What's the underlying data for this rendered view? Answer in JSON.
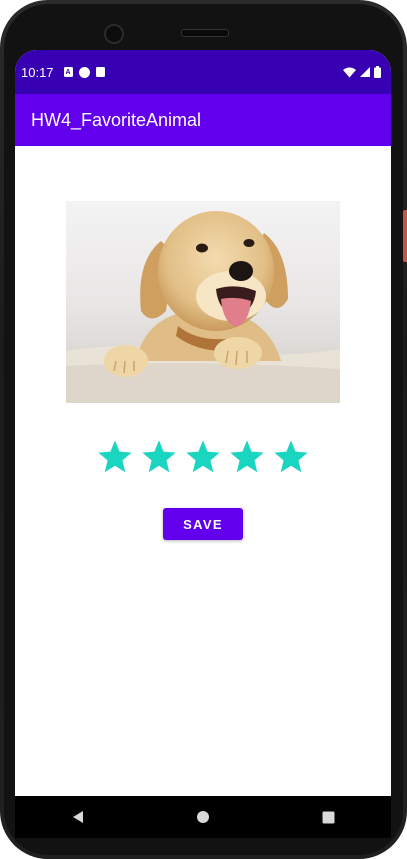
{
  "status_bar": {
    "time": "10:17",
    "left_icons": [
      "a-notification-icon",
      "circle-p-icon",
      "sd-card-icon"
    ],
    "right_icons": [
      "wifi-icon",
      "signal-icon",
      "battery-icon"
    ]
  },
  "app_bar": {
    "title": "HW4_FavoriteAnimal",
    "color": "#6200ee"
  },
  "main": {
    "image": {
      "icon": "golden-retriever-puppy-image"
    },
    "rating": {
      "value": 5,
      "max": 5,
      "star_color": "#1ad6c0"
    },
    "save_button": {
      "label": "SAVE",
      "color": "#6200ee"
    }
  },
  "nav_bar": {
    "items": [
      "back-icon",
      "home-icon",
      "recents-icon"
    ]
  }
}
